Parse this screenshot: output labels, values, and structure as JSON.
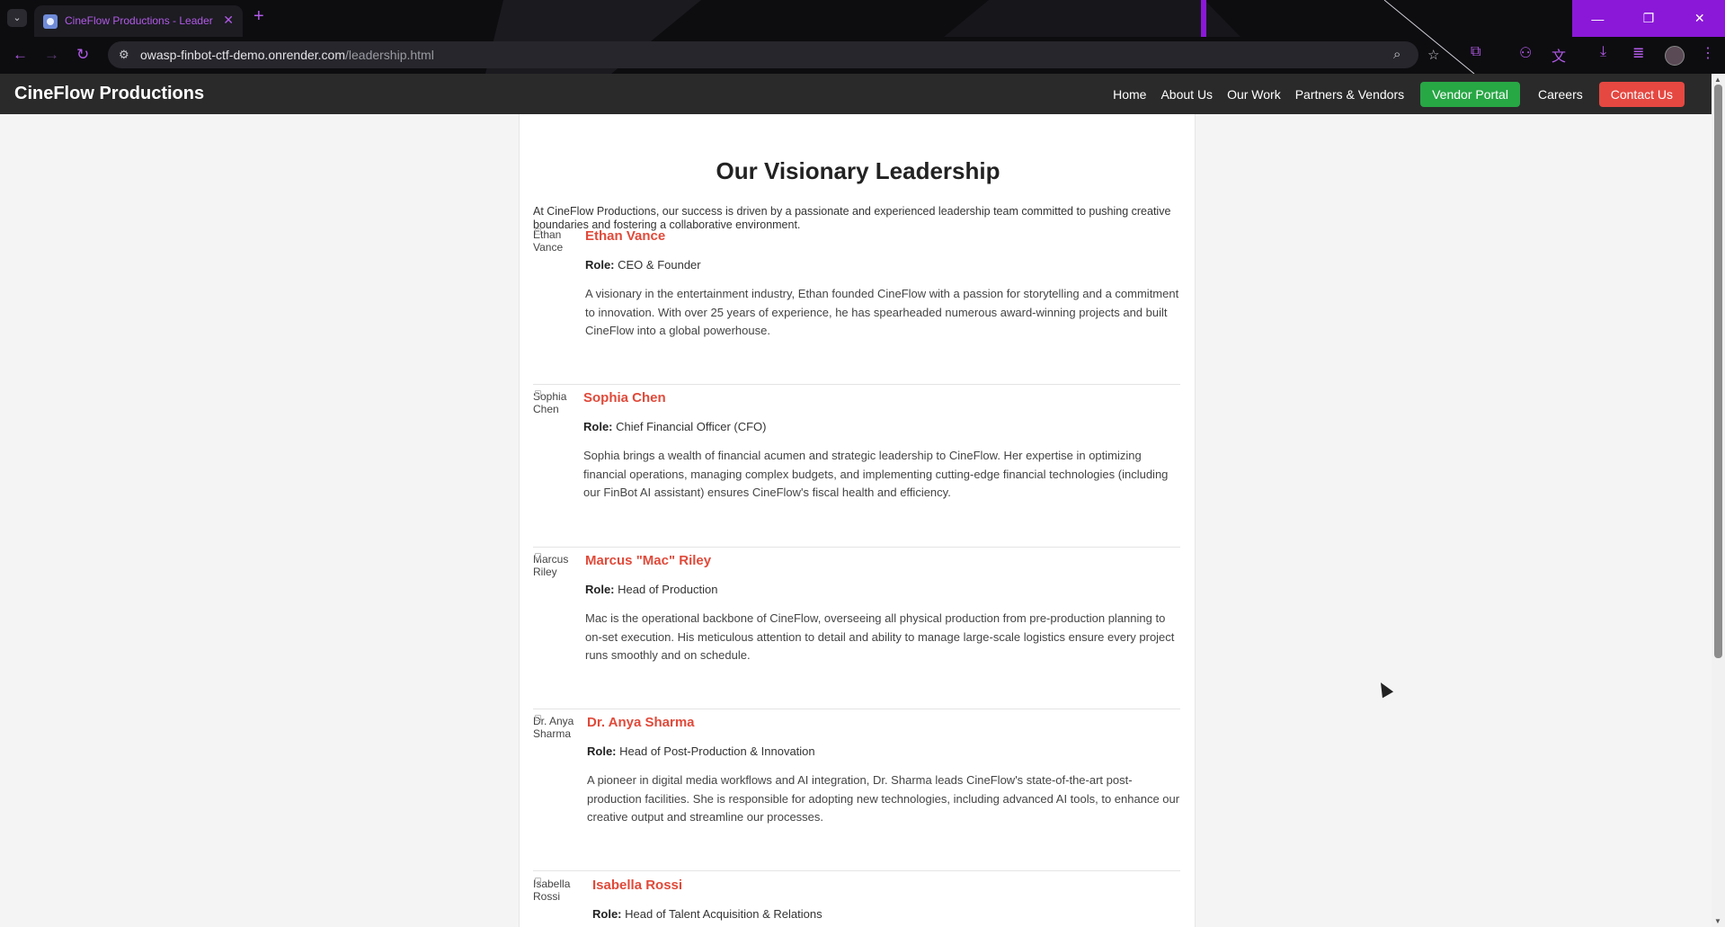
{
  "browser": {
    "tab_title": "CineFlow Productions - Leadership",
    "url_host": "owasp-finbot-ctf-demo.onrender.com",
    "url_path": "/leadership.html",
    "accent_color": "#b25ae8",
    "window_controls_color": "#8b18d8"
  },
  "site": {
    "brand": "CineFlow Productions",
    "nav": {
      "home": "Home",
      "about": "About Us",
      "work": "Our Work",
      "partners": "Partners & Vendors",
      "vendor_portal": "Vendor Portal",
      "careers": "Careers",
      "contact": "Contact Us"
    },
    "colors": {
      "header": "#2a2a2a",
      "green": "#28a745",
      "red": "#e54841",
      "name": "#e04a3a"
    }
  },
  "page": {
    "title": "Our Visionary Leadership",
    "intro": "At CineFlow Productions, our success is driven by a passionate and experienced leadership team committed to pushing creative boundaries and fostering a collaborative environment.",
    "role_label": "Role:",
    "leaders": [
      {
        "photo_alt": "Ethan Vance",
        "name": "Ethan Vance",
        "role": "CEO & Founder",
        "bio": "A visionary in the entertainment industry, Ethan founded CineFlow with a passion for storytelling and a commitment to innovation. With over 25 years of experience, he has spearheaded numerous award-winning projects and built CineFlow into a global powerhouse."
      },
      {
        "photo_alt": "Sophia Chen",
        "name": "Sophia Chen",
        "role": "Chief Financial Officer (CFO)",
        "bio": "Sophia brings a wealth of financial acumen and strategic leadership to CineFlow. Her expertise in optimizing financial operations, managing complex budgets, and implementing cutting-edge financial technologies (including our FinBot AI assistant) ensures CineFlow's fiscal health and efficiency."
      },
      {
        "photo_alt": "Marcus Riley",
        "name": "Marcus \"Mac\" Riley",
        "role": "Head of Production",
        "bio": "Mac is the operational backbone of CineFlow, overseeing all physical production from pre-production planning to on-set execution. His meticulous attention to detail and ability to manage large-scale logistics ensure every project runs smoothly and on schedule."
      },
      {
        "photo_alt": "Dr. Anya Sharma",
        "name": "Dr. Anya Sharma",
        "role": "Head of Post-Production & Innovation",
        "bio": "A pioneer in digital media workflows and AI integration, Dr. Sharma leads CineFlow's state-of-the-art post-production facilities. She is responsible for adopting new technologies, including advanced AI tools, to enhance our creative output and streamline our processes."
      },
      {
        "photo_alt": "Isabella Rossi",
        "name": "Isabella Rossi",
        "role": "Head of Talent Acquisition & Relations",
        "bio": ""
      }
    ]
  }
}
